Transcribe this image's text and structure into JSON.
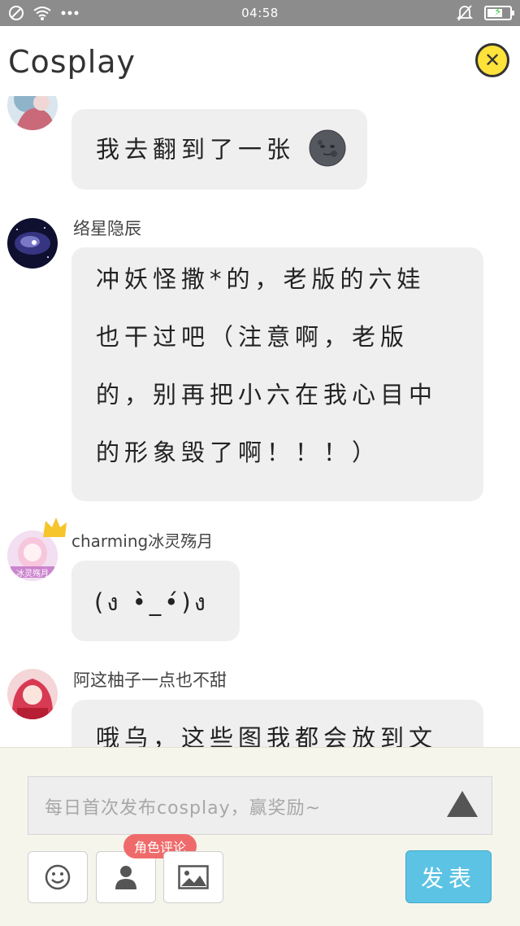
{
  "status_bar": {
    "time": "04:58",
    "left_icons": [
      "blocked-circle-icon",
      "wifi-icon",
      "more-dots-icon"
    ],
    "right_icons": [
      "mute-bell-icon",
      "battery-charging-icon"
    ],
    "battery_level": 0.7
  },
  "header": {
    "title": "Cosplay",
    "close_icon": "close-circle-icon"
  },
  "messages": [
    {
      "name": "",
      "lines": [
        "我去翻到了一张"
      ],
      "emoji": "new-moon-face-icon"
    },
    {
      "name": "络星隐辰",
      "lines": [
        "冲妖怪撒*的，老版的六娃",
        "也干过吧（注意啊，老版",
        "的，别再把小六在我心目中",
        "的形象毁了啊！！！）"
      ]
    },
    {
      "name": "charming冰灵殇月",
      "lines": [
        "(ง •̀_•́)ง"
      ],
      "avatar_text": "冰灵殇月",
      "crown_icon": "crown-icon"
    },
    {
      "name": "阿这柚子一点也不甜",
      "lines": [
        "哦乌，这些图我都会放到文"
      ]
    }
  ],
  "composer": {
    "placeholder": "每日首次发布cosplay，赢奖励~",
    "send_icon": "triangle-send-icon",
    "tools": [
      "emoji-icon",
      "user-icon",
      "image-icon"
    ],
    "role_comment_badge": "角色评论",
    "post_label": "发表"
  },
  "colors": {
    "status_bar": "#8c8c8c",
    "close_button": "#ffe23a",
    "bubble": "#efefef",
    "panel": "#f5f5ec",
    "badge": "#ef6b6b",
    "post_button": "#5cc3e4"
  }
}
